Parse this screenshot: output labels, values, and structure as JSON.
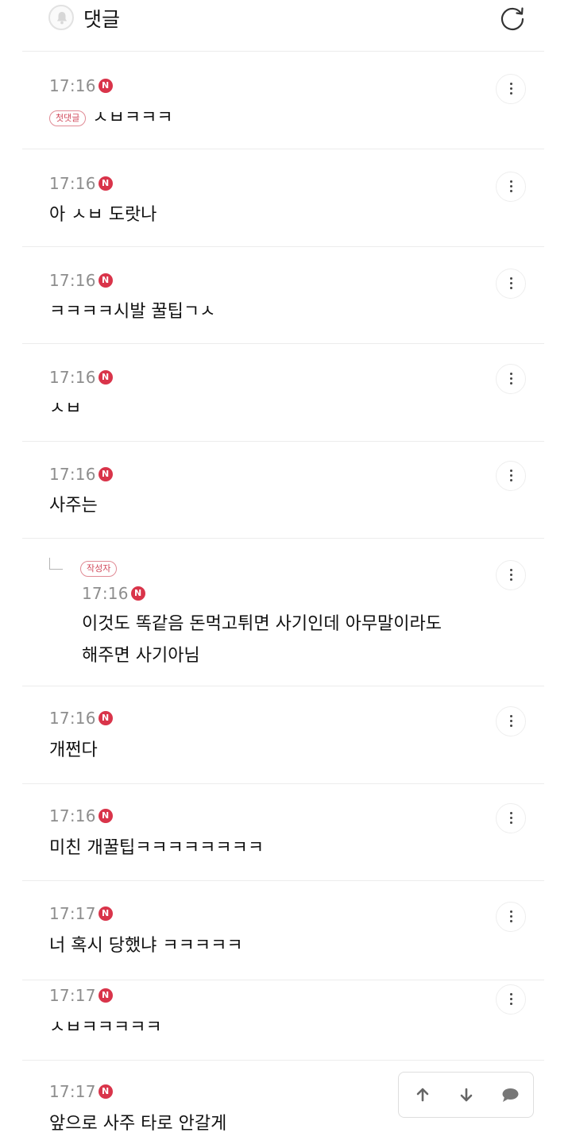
{
  "header": {
    "title": "댓글",
    "bell_icon": "bell-icon",
    "refresh_icon": "refresh-icon"
  },
  "new_badge": "N",
  "comments": [
    {
      "time": "17:16",
      "tag": "첫댓글",
      "text": "ㅅㅂㅋㅋㅋ"
    },
    {
      "time": "17:16",
      "text": "아 ㅅㅂ 도랏나"
    },
    {
      "time": "17:16",
      "text": "ㅋㅋㅋㅋ시발 꿀팁ㄱㅅ"
    },
    {
      "time": "17:16",
      "text": "ㅅㅂ"
    },
    {
      "time": "17:16",
      "text": "사주는"
    },
    {
      "time": "17:16",
      "tag": "작성자",
      "reply": true,
      "text_line1": "이것도 똑같음 돈먹고튀면 사기인데 아무말이라도",
      "text_line2": "해주면 사기아님"
    },
    {
      "time": "17:16",
      "text": "개쩐다"
    },
    {
      "time": "17:16",
      "text": "미친 개꿀팁ㅋㅋㅋㅋㅋㅋㅋㅋ"
    },
    {
      "time": "17:17",
      "text": "너 혹시 당했냐 ㅋㅋㅋㅋㅋ"
    },
    {
      "time": "17:17",
      "text": "ㅅㅂㅋㅋㅋㅋㅋ"
    },
    {
      "time": "17:17",
      "text": "앞으로 사주 타로 안갈게"
    }
  ],
  "icons": {
    "more": "more-options-icon",
    "reply": "reply-arrow-icon",
    "up": "arrow-up-icon",
    "down": "arrow-down-icon",
    "chat": "chat-bubble-icon"
  }
}
